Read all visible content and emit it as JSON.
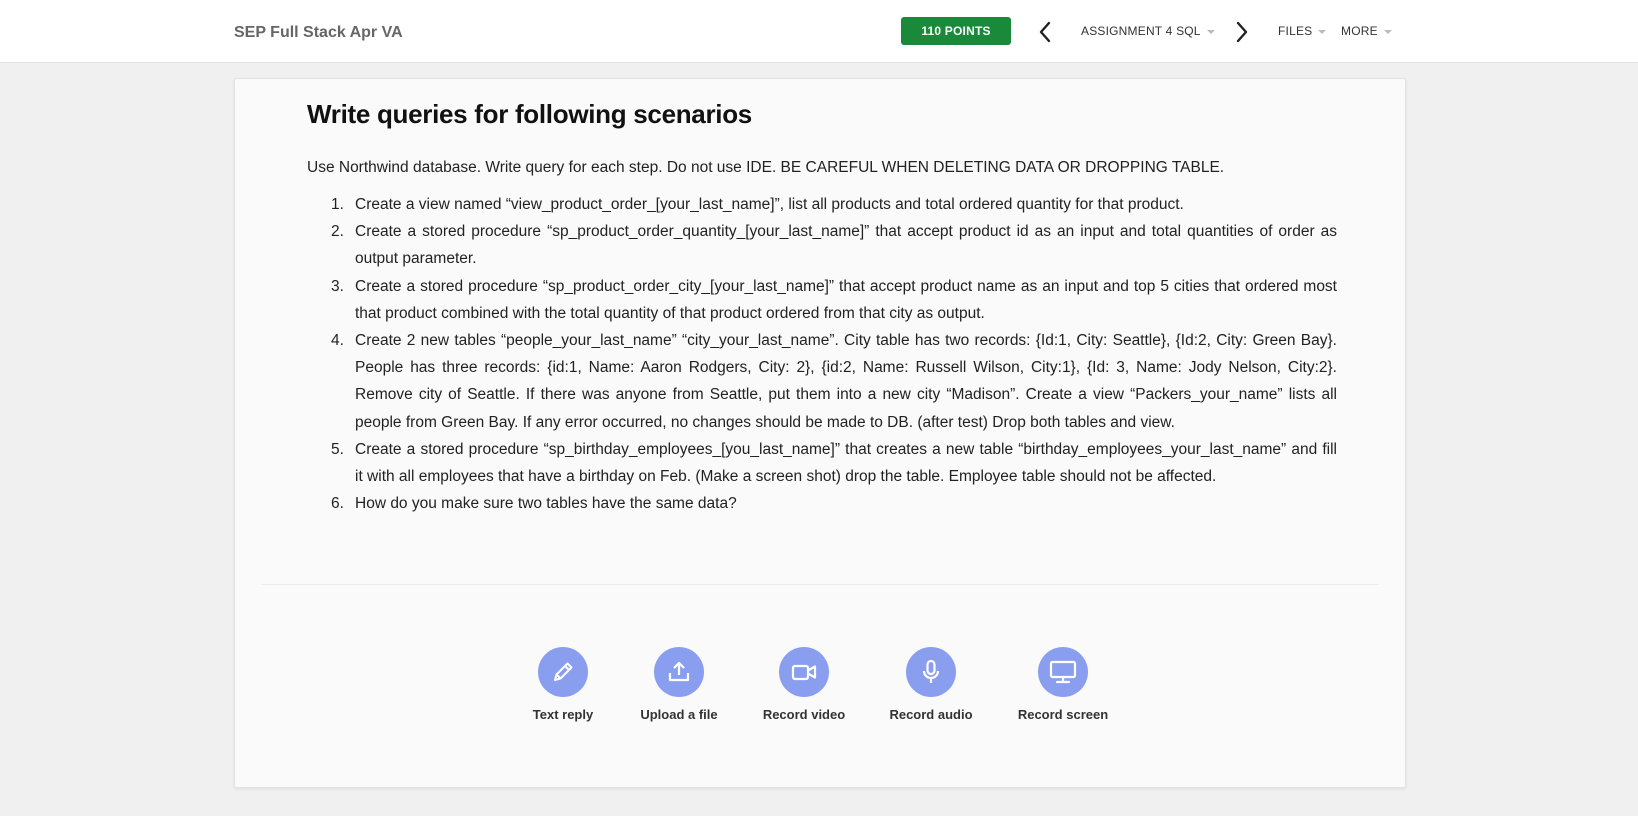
{
  "header": {
    "course_title": "SEP Full Stack Apr VA",
    "points": "110 POINTS",
    "assignment_menu": "ASSIGNMENT 4 SQL",
    "files_menu": "FILES",
    "more_menu": "MORE",
    "prev_icon": "chevron-left-icon",
    "next_icon": "chevron-right-icon"
  },
  "assignment": {
    "heading": "Write queries for following scenarios",
    "intro": "Use Northwind database.  Write query for each step. Do not use IDE. BE CAREFUL WHEN DELETING DATA OR DROPPING TABLE.",
    "steps": [
      {
        "num": "1.",
        "text": "Create a view named “view_product_order_[your_last_name]”, list all products and total ordered quantity for that product."
      },
      {
        "num": "2.",
        "text": "Create a stored procedure “sp_product_order_quantity_[your_last_name]” that accept product id as an input and total quantities of order as output parameter."
      },
      {
        "num": "3.",
        "text": "Create a stored procedure “sp_product_order_city_[your_last_name]” that accept product name as an input and top 5 cities that ordered most that product combined with the total quantity of that product ordered from that city as output."
      },
      {
        "num": "4.",
        "text": "Create 2 new tables “people_your_last_name” “city_your_last_name”. City table has two records: {Id:1, City: Seattle}, {Id:2, City: Green Bay}. People has three records: {id:1, Name: Aaron Rodgers, City: 2}, {id:2, Name: Russell Wilson, City:1}, {Id: 3, Name: Jody Nelson, City:2}. Remove city of Seattle. If there was anyone from Seattle, put them into a new city “Madison”. Create a view “Packers_your_name” lists all people from Green Bay. If any error occurred, no changes should be made to DB. (after test) Drop both tables and view."
      },
      {
        "num": "5.",
        "text": "Create a stored procedure “sp_birthday_employees_[you_last_name]” that creates a new table “birthday_employees_your_last_name” and fill it with all employees that have a birthday on Feb. (Make a screen shot) drop the table. Employee table should not be affected."
      },
      {
        "num": "6.",
        "text": "How do you make sure two tables have the same data?"
      }
    ]
  },
  "submission_options": [
    {
      "label": "Text reply",
      "icon": "pencil-icon"
    },
    {
      "label": "Upload a file",
      "icon": "upload-icon"
    },
    {
      "label": "Record video",
      "icon": "video-camera-icon"
    },
    {
      "label": "Record audio",
      "icon": "microphone-icon"
    },
    {
      "label": "Record screen",
      "icon": "monitor-icon"
    }
  ],
  "colors": {
    "points_badge": "#1a8a3a",
    "action_circle": "#8a9ef0",
    "page_background": "#f0f0f0"
  }
}
